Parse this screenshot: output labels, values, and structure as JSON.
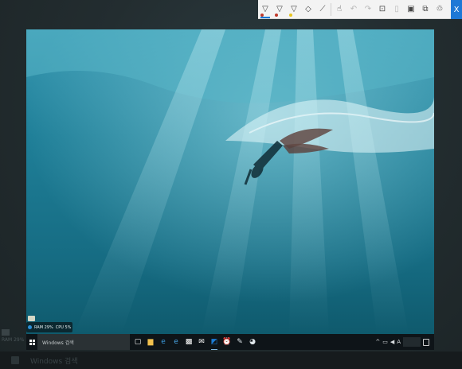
{
  "desktop": {
    "ghost_taskbar_text": "Windows 검색",
    "ghost_status": "RAM 29%"
  },
  "ink_toolbar": {
    "tools": [
      {
        "name": "ballpoint-pen",
        "icon": "▽",
        "dot": "#c0392b",
        "active": true
      },
      {
        "name": "pencil",
        "icon": "▽",
        "dot": "#c0392b",
        "active": false
      },
      {
        "name": "highlighter",
        "icon": "▽",
        "dot": "#e8c51d",
        "active": false
      },
      {
        "name": "eraser",
        "icon": "◇",
        "active": false
      },
      {
        "name": "ruler",
        "icon": "⟋",
        "active": false
      }
    ],
    "actions": [
      {
        "name": "touch-writing",
        "icon": "☝",
        "enabled": true
      },
      {
        "name": "undo",
        "icon": "↶",
        "enabled": false
      },
      {
        "name": "redo",
        "icon": "↷",
        "enabled": false
      },
      {
        "name": "crop",
        "icon": "⊡",
        "enabled": true
      },
      {
        "name": "copy",
        "icon": "▯",
        "enabled": false
      },
      {
        "name": "save",
        "icon": "▣",
        "enabled": true
      },
      {
        "name": "copy-to-clipboard",
        "icon": "⧉",
        "enabled": true
      },
      {
        "name": "share",
        "icon": "♲",
        "enabled": true
      }
    ],
    "close_label": "X"
  },
  "capture": {
    "gadget": {
      "ram": "RAM 29%",
      "cpu": "CPU 5%"
    },
    "taskbar": {
      "search_placeholder": "Windows 검색",
      "apps": [
        {
          "name": "task-view",
          "icon": "▢",
          "color": "#ffffff",
          "running": false
        },
        {
          "name": "file-explorer",
          "icon": "▆",
          "color": "#f2c14e",
          "running": false
        },
        {
          "name": "edge-browser",
          "icon": "e",
          "color": "#3a9ce0",
          "running": false
        },
        {
          "name": "internet-explorer",
          "icon": "e",
          "color": "#4aa8e8",
          "running": false
        },
        {
          "name": "store",
          "icon": "▩",
          "color": "#ffffff",
          "running": false
        },
        {
          "name": "mail",
          "icon": "✉",
          "color": "#ffffff",
          "running": false
        },
        {
          "name": "snip-tool",
          "icon": "◩",
          "color": "#1b7bd4",
          "running": true
        },
        {
          "name": "alarm-clock",
          "icon": "⏰",
          "color": "#ffffff",
          "running": false
        },
        {
          "name": "screen-sketch",
          "icon": "✎",
          "color": "#dfe6ea",
          "running": false
        },
        {
          "name": "paint-tool",
          "icon": "◕",
          "color": "#dfe6ea",
          "running": false
        }
      ],
      "tray": {
        "chevron": "^",
        "network": "▭",
        "volume": "◀",
        "ime": "A"
      }
    }
  }
}
